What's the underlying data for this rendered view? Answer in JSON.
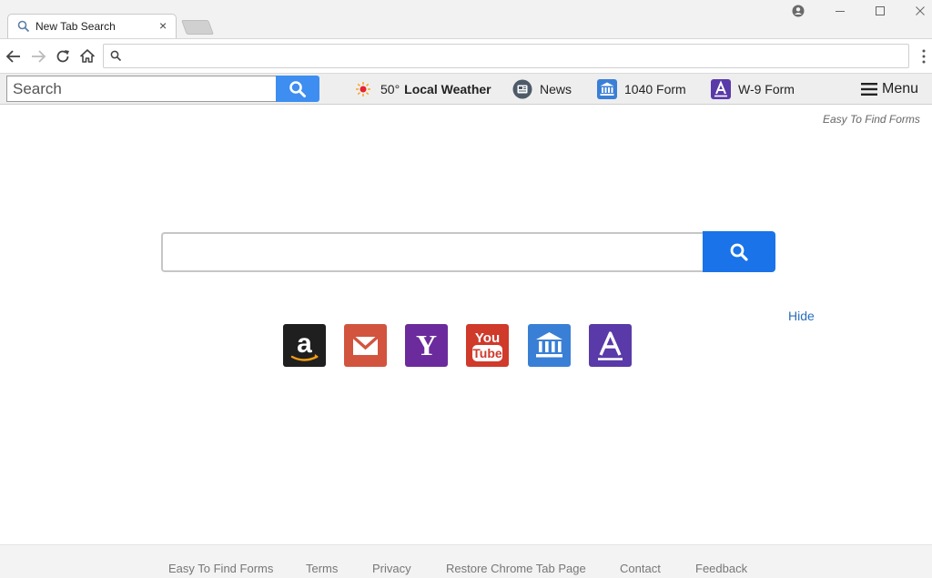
{
  "browser": {
    "tab_title": "New Tab Search",
    "tab_close": "×",
    "url": ""
  },
  "toolbar": {
    "search_placeholder": "Search",
    "weather_temp": "50°",
    "weather_label": "Local Weather",
    "news_label": "News",
    "form1040_label": "1040 Form",
    "w9_label": "W-9 Form",
    "menu_label": "Menu"
  },
  "brand": "Easy To Find Forms",
  "main": {
    "search_value": "",
    "hide_label": "Hide",
    "tiles": [
      "amazon-icon",
      "gmail-icon",
      "yahoo-icon",
      "youtube-icon",
      "bank-icon",
      "forms-icon"
    ]
  },
  "footer": {
    "links": [
      "Easy To Find Forms",
      "Terms",
      "Privacy",
      "Restore Chrome Tab Page",
      "Contact",
      "Feedback"
    ]
  },
  "colors": {
    "accent_blue": "#1a73e8",
    "toolbar_blue": "#3d8ef0",
    "amazon": "#1f1f1f",
    "gmail": "#d2543f",
    "yahoo": "#6b2b9c",
    "youtube": "#cf3a2b",
    "bank": "#3a7fd6",
    "forms": "#5a3aa8"
  }
}
